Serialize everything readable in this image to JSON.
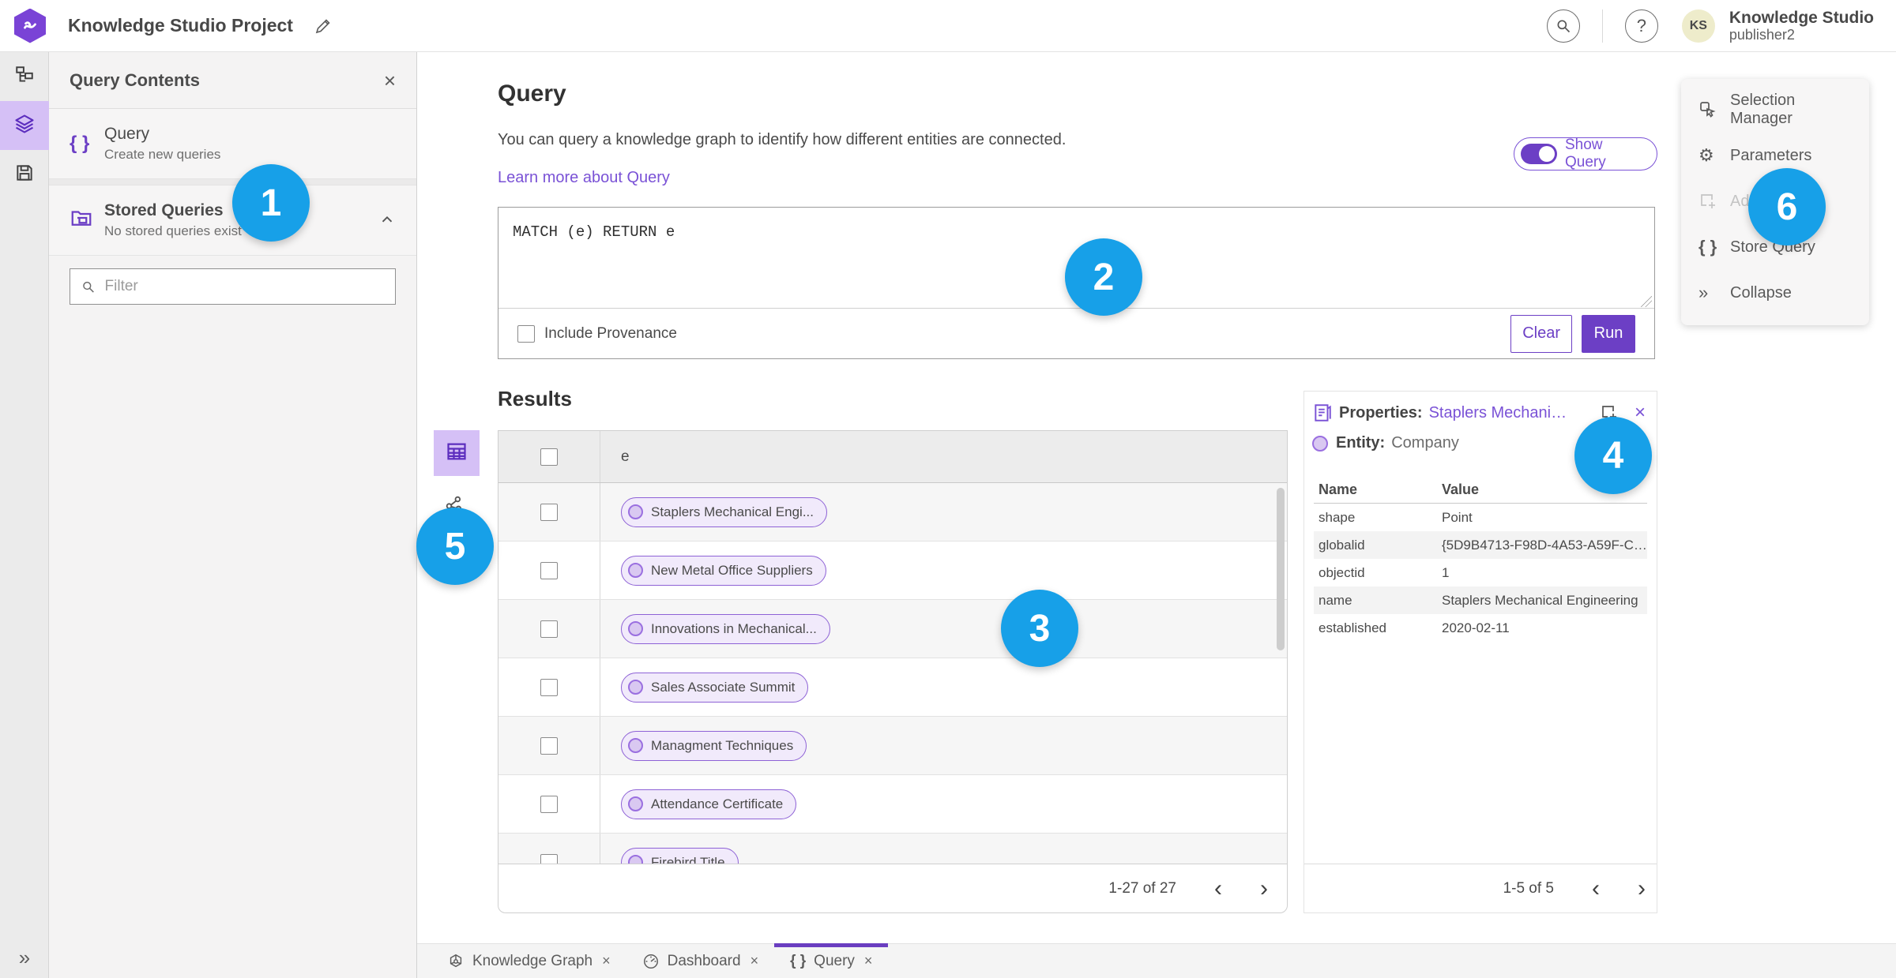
{
  "top_bar": {
    "title": "Knowledge Studio Project",
    "user": {
      "initials": "KS",
      "name": "Knowledge Studio",
      "subtitle": "publisher2"
    }
  },
  "icons": {
    "close": "×",
    "help": "?",
    "braces": "{ }",
    "gear": "⚙",
    "collapse": "»",
    "rail_expand": "»",
    "chevron_left": "‹",
    "chevron_right": "›"
  },
  "colors": {
    "accent_purple": "#6c3fc5",
    "link_purple": "#7a52d6",
    "annotation_blue": "#17a0e8",
    "avatar_yellow": "#eeeccb",
    "rail_selected": "#d5c0f6"
  },
  "contents_panel": {
    "title": "Query Contents",
    "items": [
      {
        "label": "Query",
        "sublabel": "Create new queries"
      },
      {
        "label": "Stored Queries",
        "sublabel": "No stored queries exist"
      }
    ],
    "filter_placeholder": "Filter"
  },
  "query_section": {
    "title": "Query",
    "description": "You can query a knowledge graph to identify how different entities are connected.",
    "learn_more": "Learn more about Query",
    "show_query_label": "Show Query",
    "query_text": "MATCH (e) RETURN e",
    "include_provenance_label": "Include Provenance",
    "clear_label": "Clear",
    "run_label": "Run"
  },
  "results": {
    "title": "Results",
    "column_header": "e",
    "rows": [
      "Staplers Mechanical Engi...",
      "New Metal Office Suppliers",
      "Innovations in Mechanical...",
      "Sales Associate Summit",
      "Managment Techniques",
      "Attendance Certificate",
      "Firebird Title"
    ],
    "pagination": "1-27 of 27"
  },
  "properties_panel": {
    "title_label": "Properties:",
    "title_link": "Staplers Mechanic...",
    "entity_label": "Entity:",
    "entity_value": "Company",
    "columns": {
      "name": "Name",
      "value": "Value"
    },
    "rows": [
      {
        "name": "shape",
        "value": "Point"
      },
      {
        "name": "globalid",
        "value": "{5D9B4713-F98D-4A53-A59F-C11..."
      },
      {
        "name": "objectid",
        "value": "1"
      },
      {
        "name": "name",
        "value": "Staplers Mechanical Engineering"
      },
      {
        "name": "established",
        "value": "2020-02-11"
      }
    ],
    "pagination": "1-5 of 5"
  },
  "action_menu": {
    "items": [
      {
        "label": "Selection Manager",
        "disabled": false
      },
      {
        "label": "Parameters",
        "disabled": false
      },
      {
        "label": "Ad",
        "disabled": true
      },
      {
        "label": "Store Query",
        "disabled": false
      },
      {
        "label": "Collapse",
        "disabled": false
      }
    ]
  },
  "bottom_tabs": [
    {
      "label": "Knowledge Graph"
    },
    {
      "label": "Dashboard"
    },
    {
      "label": "Query",
      "active": true
    }
  ],
  "annotations": [
    {
      "n": "1"
    },
    {
      "n": "2"
    },
    {
      "n": "3"
    },
    {
      "n": "4"
    },
    {
      "n": "5"
    },
    {
      "n": "6"
    }
  ]
}
